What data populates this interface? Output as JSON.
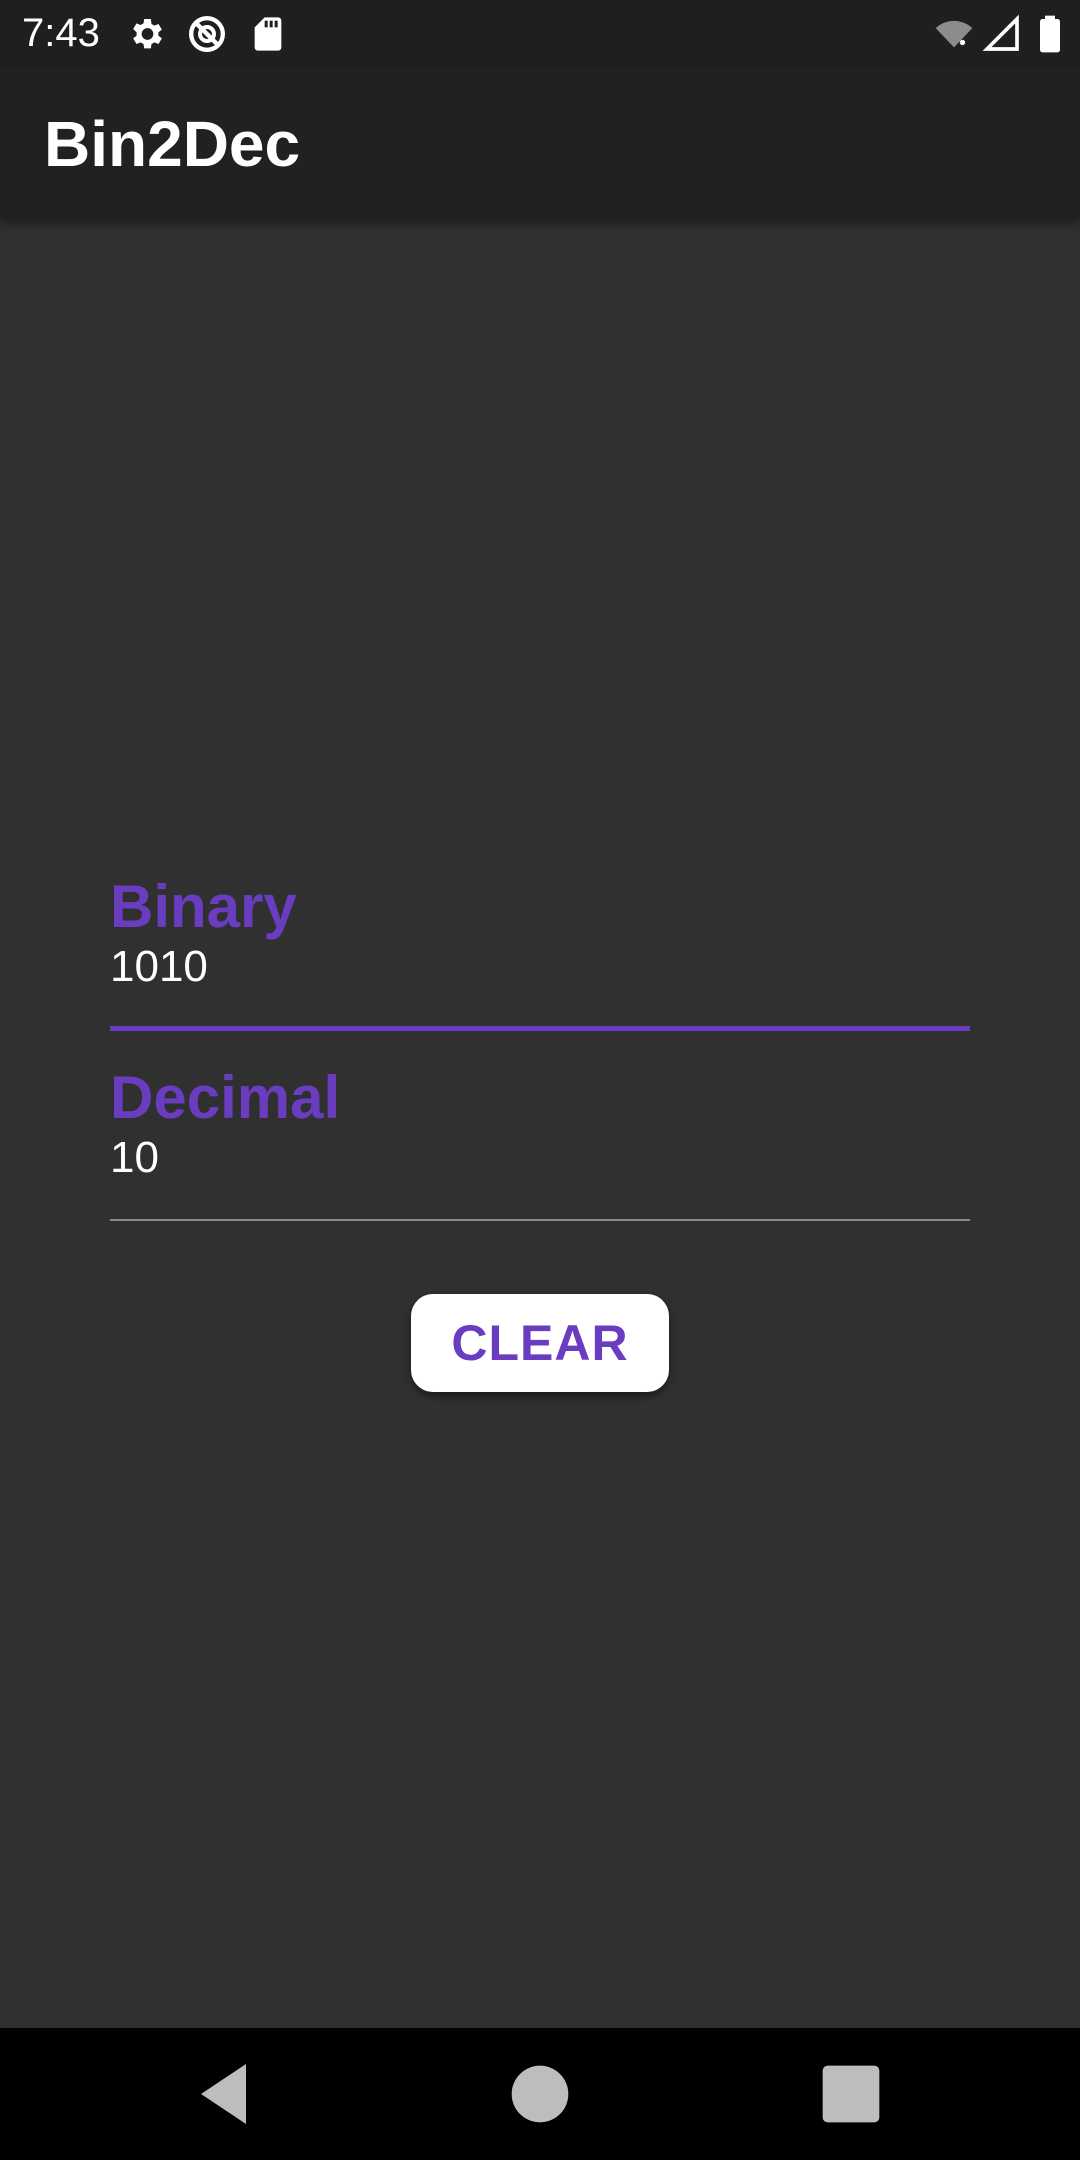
{
  "status_bar": {
    "time": "7:43",
    "left_icons": [
      "gear-icon",
      "do-not-disturb-icon",
      "sd-card-icon"
    ],
    "right_icons": [
      "wifi-off-icon",
      "cell-signal-icon",
      "battery-icon"
    ]
  },
  "app_bar": {
    "title": "Bin2Dec"
  },
  "binary_field": {
    "label": "Binary",
    "value": "1010",
    "focused": true
  },
  "decimal_field": {
    "label": "Decimal",
    "value": "10"
  },
  "clear_button": {
    "label": "CLEAR"
  },
  "nav_bar": {
    "buttons": [
      "back-icon",
      "home-icon",
      "recents-icon"
    ]
  },
  "colors": {
    "accent": "#6a3dc0",
    "background": "#303030",
    "app_bar": "#212121",
    "status_bar": "#1f1f1f",
    "nav_bar": "#000000"
  }
}
